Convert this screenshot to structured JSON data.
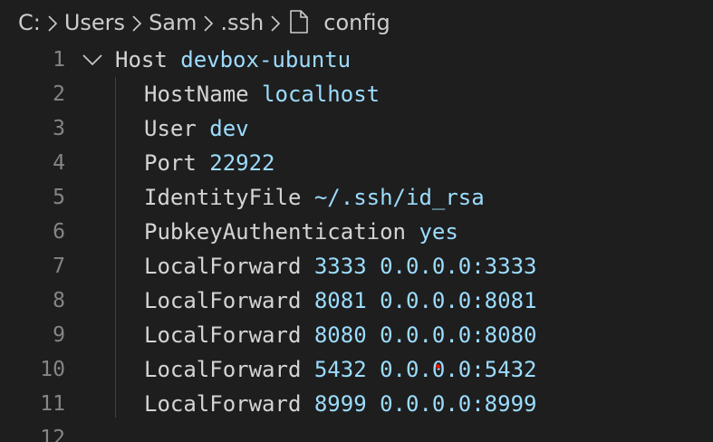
{
  "breadcrumb": {
    "items": [
      "C:",
      "Users",
      "Sam",
      ".ssh"
    ],
    "file": "config",
    "file_icon": "file-icon",
    "separator_icon": "chevron-right-icon"
  },
  "colors": {
    "background": "#1e1e1e",
    "keyword": "#d4d4d4",
    "value": "#9cdcfe",
    "line_number": "#858585"
  },
  "editor": {
    "lines": [
      {
        "num": "1",
        "key": "Host",
        "value": "devbox-ubuntu",
        "fold": "chevron-down-icon"
      },
      {
        "num": "2",
        "key": "HostName",
        "value": "localhost"
      },
      {
        "num": "3",
        "key": "User",
        "value": "dev"
      },
      {
        "num": "4",
        "key": "Port",
        "value": "22922"
      },
      {
        "num": "5",
        "key": "IdentityFile",
        "value": "~/.ssh/id_rsa"
      },
      {
        "num": "6",
        "key": "PubkeyAuthentication",
        "value": "yes"
      },
      {
        "num": "7",
        "key": "LocalForward",
        "value": "3333 0.0.0.0:3333"
      },
      {
        "num": "8",
        "key": "LocalForward",
        "value": "8081 0.0.0.0:8081"
      },
      {
        "num": "9",
        "key": "LocalForward",
        "value": "8080 0.0.0.0:8080"
      },
      {
        "num": "10",
        "key": "LocalForward",
        "value": "5432 0.0.0.0:5432"
      },
      {
        "num": "11",
        "key": "LocalForward",
        "value": "8999 0.0.0.0:8999"
      },
      {
        "num": "12",
        "key": "",
        "value": ""
      }
    ]
  }
}
